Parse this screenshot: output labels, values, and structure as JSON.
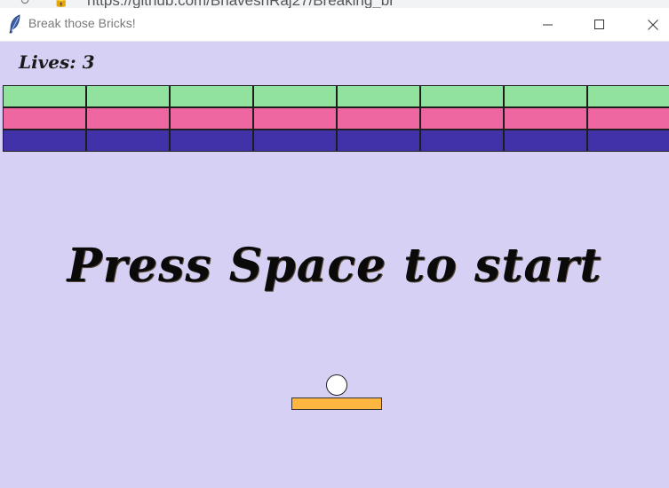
{
  "browser": {
    "url_fragment": "https://github.com/BhaveshRaj27/Breaking_br"
  },
  "window": {
    "title": "Break those Bricks!",
    "icon": "feather-icon",
    "controls": [
      "minimize-icon",
      "maximize-icon",
      "close-icon"
    ]
  },
  "game": {
    "lives_text": "Lives: 3",
    "lives": 3,
    "prompt": "Press Space to start",
    "background_color": "#d6d0f4",
    "brick_rows": [
      {
        "color": "#90e29e",
        "count": 8
      },
      {
        "color": "#ef67a0",
        "count": 8
      },
      {
        "color": "#4232aa",
        "count": 8
      }
    ],
    "ball_color": "#ffffff",
    "paddle_color": "#ffb640"
  }
}
